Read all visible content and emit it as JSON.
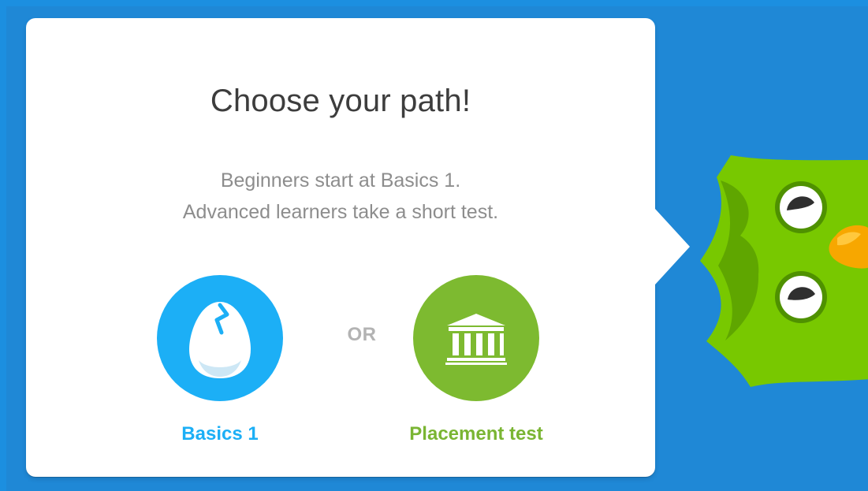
{
  "colors": {
    "background_blue": "#1c8fe0",
    "card_bg": "#ffffff",
    "basics_blue": "#1caff6",
    "placement_green": "#7dba30",
    "owl_green": "#78c800"
  },
  "card": {
    "title": "Choose your path!",
    "subtitle_line1": "Beginners start at Basics 1.",
    "subtitle_line2": "Advanced learners take a short test.",
    "separator": "OR"
  },
  "choices": [
    {
      "label": "Basics 1",
      "icon": "egg-icon"
    },
    {
      "label": "Placement test",
      "icon": "temple-icon"
    }
  ],
  "mascot": {
    "icon": "owl-mascot"
  }
}
